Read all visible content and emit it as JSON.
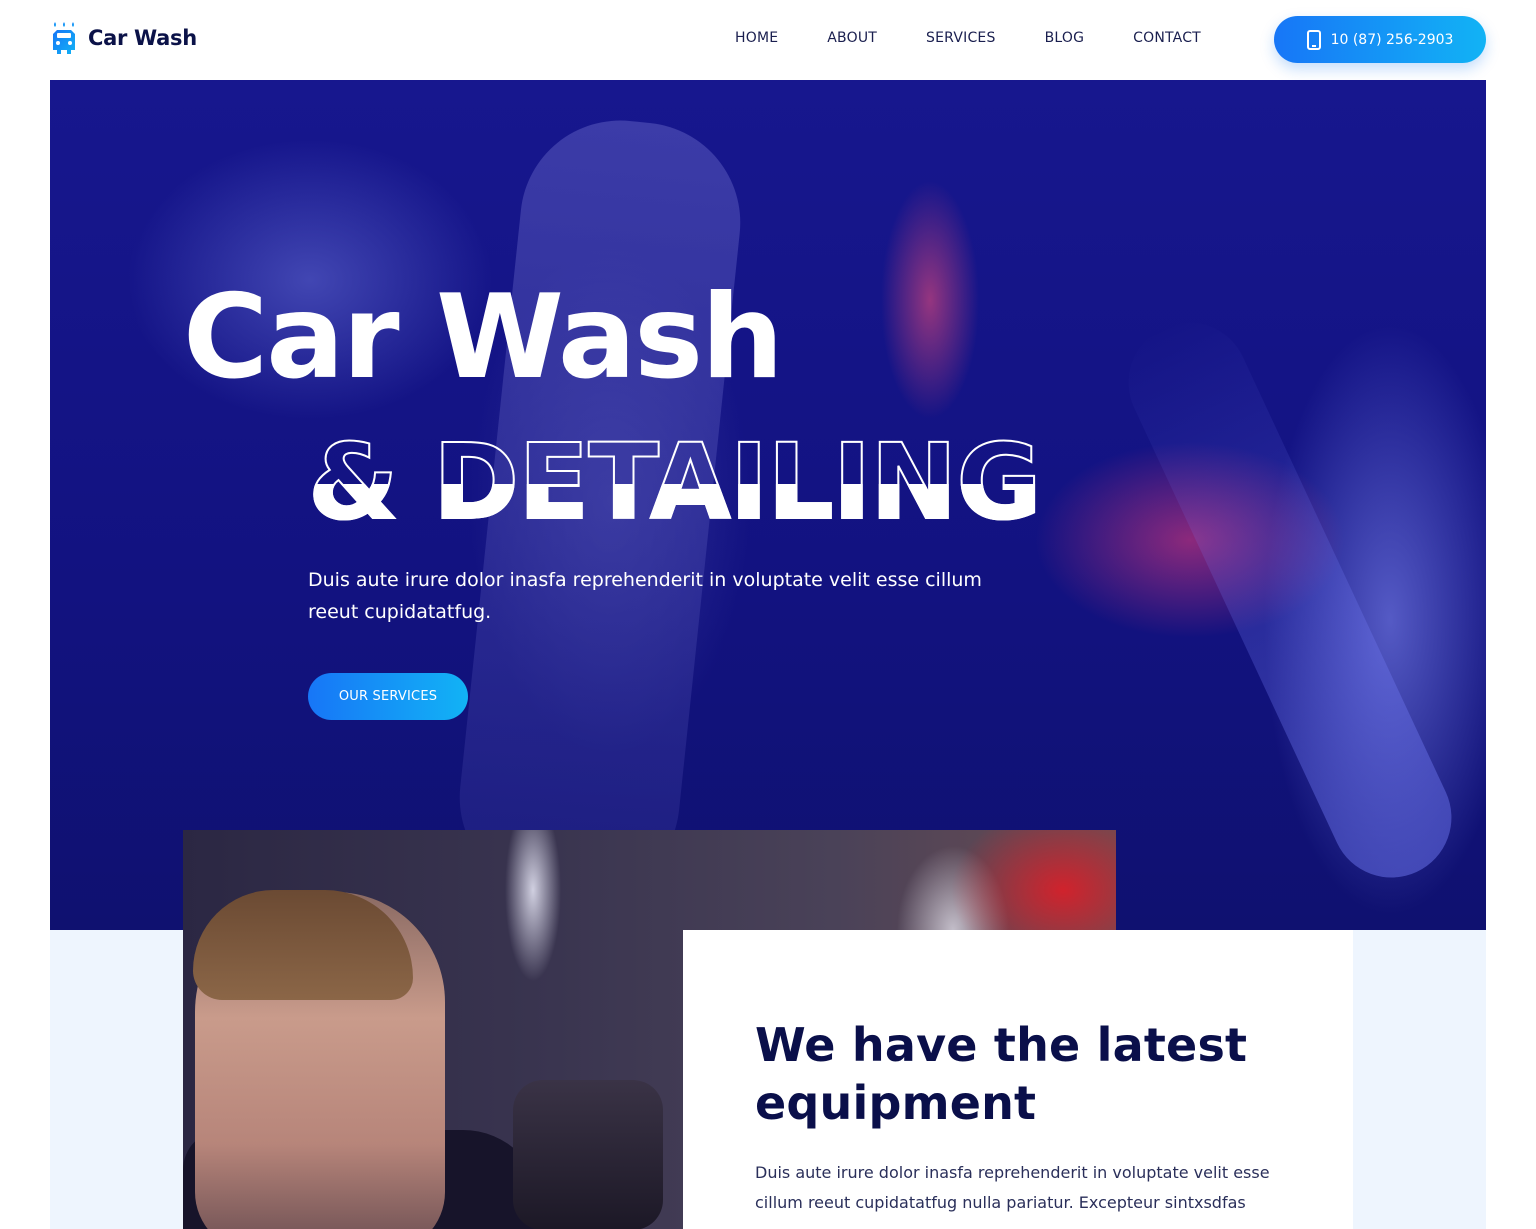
{
  "brand": {
    "name": "Car Wash",
    "icon": "car-wash-icon",
    "accent": "#1776f7"
  },
  "nav": {
    "items": [
      {
        "label": "HOME"
      },
      {
        "label": "ABOUT"
      },
      {
        "label": "SERVICES"
      },
      {
        "label": "BLOG"
      },
      {
        "label": "CONTACT"
      }
    ],
    "phone": {
      "label": "10 (87) 256-2903",
      "icon": "phone-icon"
    }
  },
  "hero": {
    "title": "Car Wash",
    "subtitle": "& DETAILING",
    "description": "Duis aute irure dolor inasfa reprehenderit in voluptate velit esse cillum reeut cupidatatfug.",
    "button": "OUR SERVICES"
  },
  "feature": {
    "title": "We have the latest equipment",
    "text": "Duis aute irure dolor inasfa reprehenderit in voluptate velit esse cillum reeut cupidatatfug nulla pariatur. Excepteur sintxsdfas"
  },
  "colors": {
    "hero_overlay": "#17178e",
    "section_bg": "#eef5fe",
    "heading": "#0a0f4a"
  }
}
